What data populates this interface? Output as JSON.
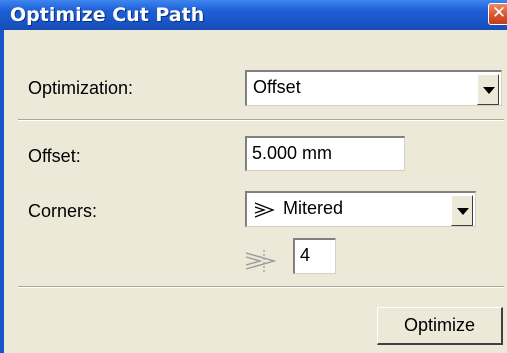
{
  "window": {
    "title": "Optimize Cut Path",
    "close_glyph": "✕"
  },
  "optimization": {
    "label": "Optimization:",
    "value": "Offset"
  },
  "offset": {
    "label": "Offset:",
    "value": "5.000 mm"
  },
  "corners": {
    "label": "Corners:",
    "value": "Mitered",
    "icon": "mitered-corner-icon"
  },
  "miter_limit": {
    "icon": "miter-limit-icon",
    "value": "4"
  },
  "actions": {
    "optimize_label": "Optimize"
  }
}
